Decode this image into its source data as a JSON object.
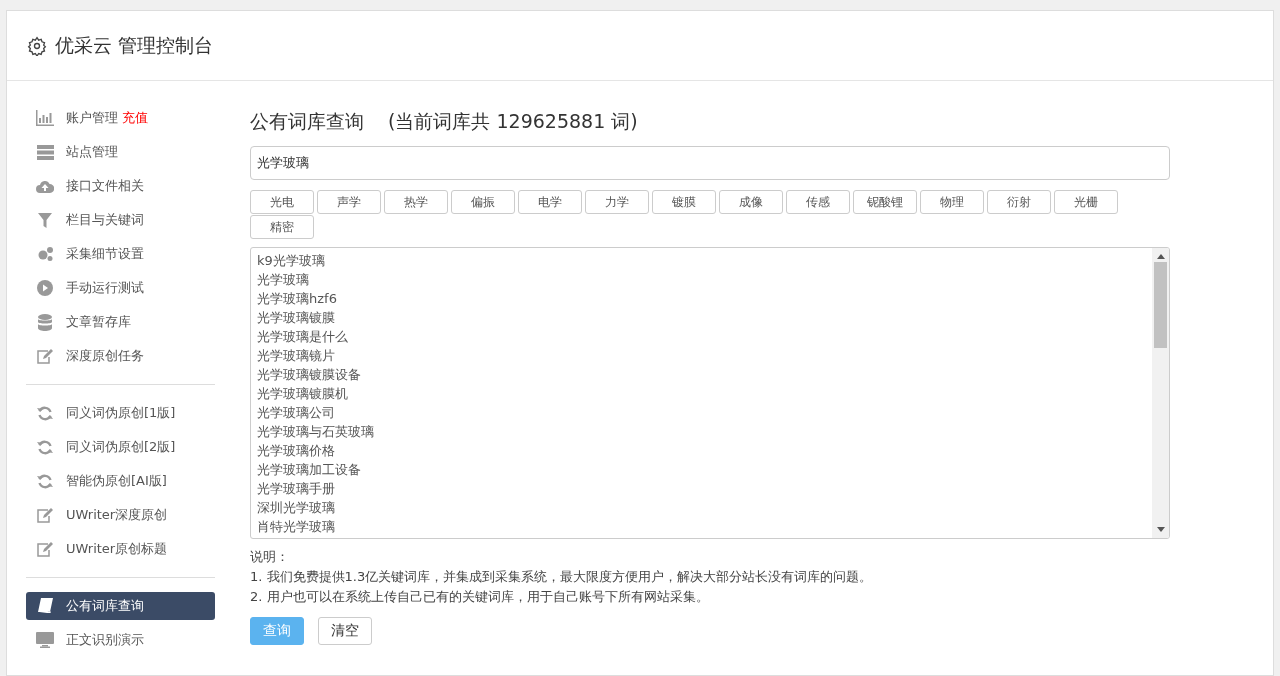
{
  "header": {
    "title": "优采云 管理控制台"
  },
  "sidebar": {
    "groups": [
      {
        "items": [
          {
            "label": "账户管理",
            "badge": "充值",
            "selected": false
          },
          {
            "label": "站点管理",
            "selected": false
          },
          {
            "label": "接口文件相关",
            "selected": false
          },
          {
            "label": "栏目与关键词",
            "selected": false
          },
          {
            "label": "采集细节设置",
            "selected": false
          },
          {
            "label": "手动运行测试",
            "selected": false
          },
          {
            "label": "文章暂存库",
            "selected": false
          },
          {
            "label": "深度原创任务",
            "selected": false
          }
        ]
      },
      {
        "items": [
          {
            "label": "同义词伪原创[1版]",
            "selected": false
          },
          {
            "label": "同义词伪原创[2版]",
            "selected": false
          },
          {
            "label": "智能伪原创[AI版]",
            "selected": false
          },
          {
            "label": "UWriter深度原创",
            "selected": false
          },
          {
            "label": "UWriter原创标题",
            "selected": false
          }
        ]
      },
      {
        "items": [
          {
            "label": "公有词库查询",
            "selected": true
          },
          {
            "label": "正文识别演示",
            "selected": false
          }
        ]
      }
    ]
  },
  "main": {
    "title": "公有词库查询",
    "subtitle": "(当前词库共 129625881 词)",
    "search": {
      "value": "光学玻璃"
    },
    "tags": [
      "光电",
      "声学",
      "热学",
      "偏振",
      "电学",
      "力学",
      "镀膜",
      "成像",
      "传感",
      "铌酸锂",
      "物理",
      "衍射",
      "光栅",
      "精密"
    ],
    "results": [
      "k9光学玻璃",
      "光学玻璃",
      "光学玻璃hzf6",
      "光学玻璃镀膜",
      "光学玻璃是什么",
      "光学玻璃镜片",
      "光学玻璃镀膜设备",
      "光学玻璃镀膜机",
      "光学玻璃公司",
      "光学玻璃与石英玻璃",
      "光学玻璃价格",
      "光学玻璃加工设备",
      "光学玻璃手册",
      "深圳光学玻璃",
      "肖特光学玻璃"
    ],
    "notes_title": "说明：",
    "notes": [
      "1. 我们免费提供1.3亿关键词库，并集成到采集系统，最大限度方便用户，解决大部分站长没有词库的问题。",
      "2. 用户也可以在系统上传自己已有的关键词库，用于自己账号下所有网站采集。"
    ],
    "buttons": [
      {
        "label": "查询",
        "kind": "primary"
      },
      {
        "label": "清空",
        "kind": "default"
      }
    ]
  }
}
